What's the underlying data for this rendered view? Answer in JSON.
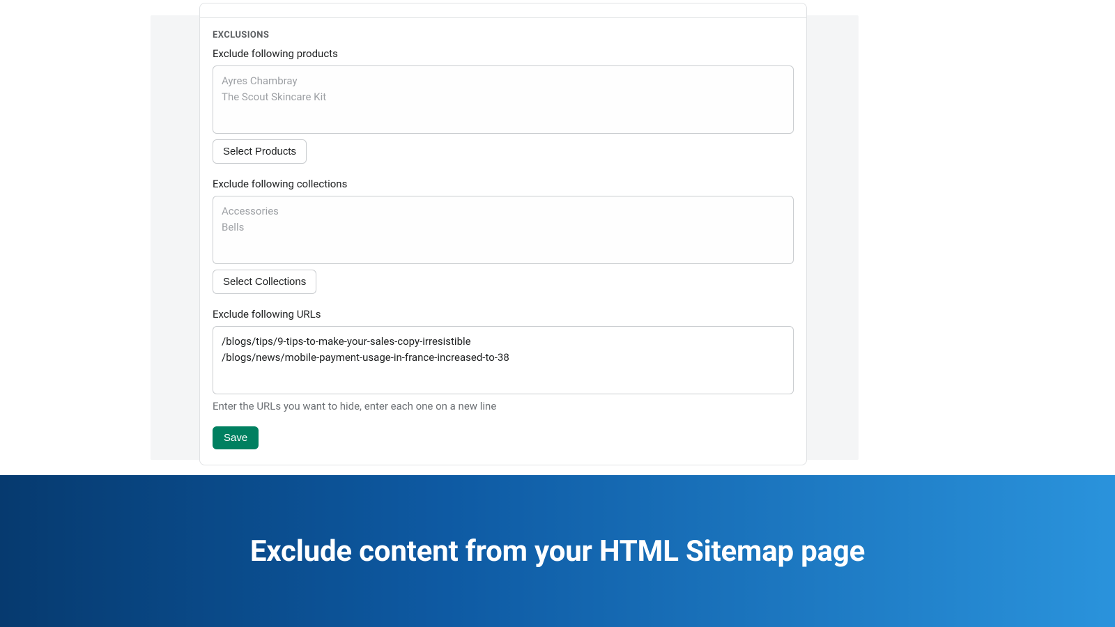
{
  "exclusions": {
    "section_title": "EXCLUSIONS",
    "products": {
      "label": "Exclude following products",
      "items": [
        "Ayres Chambray",
        "The Scout Skincare Kit"
      ],
      "button": "Select Products"
    },
    "collections": {
      "label": "Exclude following collections",
      "items": [
        "Accessories",
        "Bells"
      ],
      "button": "Select Collections"
    },
    "urls": {
      "label": "Exclude following URLs",
      "lines": [
        "/blogs/tips/9-tips-to-make-your-sales-copy-irresistible",
        "/blogs/news/mobile-payment-usage-in-france-increased-to-38"
      ],
      "help": "Enter the URLs you want to hide, enter each one on a new line"
    },
    "save": "Save"
  },
  "banner": {
    "title": "Exclude content from your HTML Sitemap page"
  }
}
